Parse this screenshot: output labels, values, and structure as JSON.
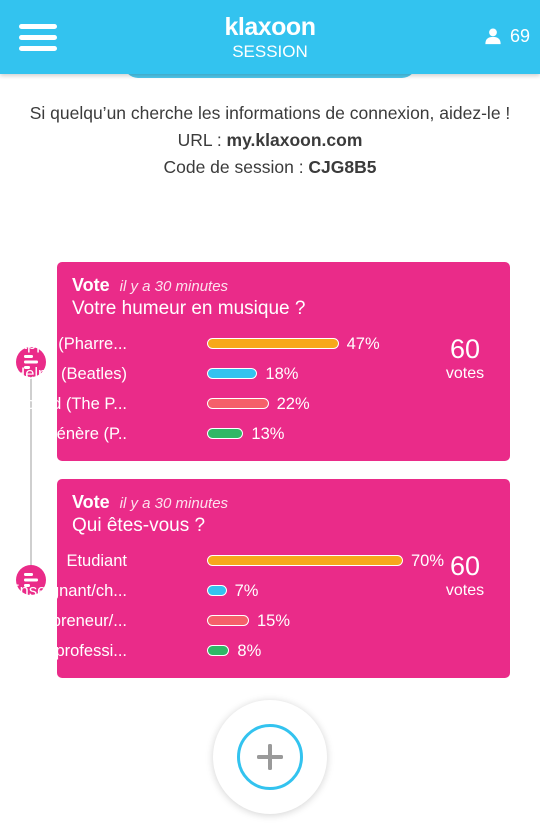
{
  "header": {
    "logo": "klaxoon",
    "session_label": "SESSION",
    "participant_count": "69",
    "bg_color": "#33c3ef"
  },
  "info": {
    "help_text": "Si quelqu’un cherche les informations de connexion, aidez-le !",
    "url_label": "URL : ",
    "url_value": "my.klaxoon.com",
    "code_label": "Code de session : ",
    "code_value": "CJG8B5"
  },
  "activities": [
    {
      "type": "Vote",
      "time": "il y a 30 minutes",
      "title": "Votre humeur en musique ?",
      "votes_count": "60",
      "votes_label": "votes",
      "options": [
        {
          "label": "Happy (Pharre...",
          "percent": 47,
          "percent_label": "47%",
          "color": "#f7a81b"
        },
        {
          "label": "Help ! (Beatles)",
          "percent": 18,
          "percent_label": "18%",
          "color": "#33c3ef"
        },
        {
          "label": "Excited (The P...",
          "percent": 22,
          "percent_label": "22%",
          "color": "#f5606a"
        },
        {
          "label": "Ça m'vénère (P..",
          "percent": 13,
          "percent_label": "13%",
          "color": "#2fb866"
        }
      ]
    },
    {
      "type": "Vote",
      "time": "il y a 30 minutes",
      "title": "Qui êtes-vous ?",
      "votes_count": "60",
      "votes_label": "votes",
      "options": [
        {
          "label": "Etudiant",
          "percent": 70,
          "percent_label": "70%",
          "color": "#f7a81b"
        },
        {
          "label": "Enseignant/ch...",
          "percent": 7,
          "percent_label": "7%",
          "color": "#33c3ef"
        },
        {
          "label": "Entrepreneur/...",
          "percent": 15,
          "percent_label": "15%",
          "color": "#f5606a"
        },
        {
          "label": "Autre professi...",
          "percent": 8,
          "percent_label": "8%",
          "color": "#2fb866"
        }
      ]
    }
  ],
  "icons": {
    "menu": "hamburger-menu-icon",
    "user": "user-icon",
    "activity": "vote-activity-icon",
    "add": "plus-icon"
  },
  "colors": {
    "accent": "#33c3ef",
    "card": "#ea2b89"
  }
}
